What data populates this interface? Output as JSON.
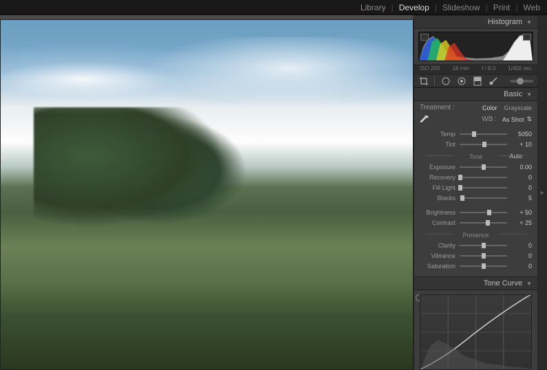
{
  "modules": {
    "library": "Library",
    "develop": "Develop",
    "slideshow": "Slideshow",
    "print": "Print",
    "web": "Web",
    "active": "develop"
  },
  "panels": {
    "histogram": "Histogram",
    "basic": "Basic",
    "tone_curve": "Tone Curve"
  },
  "histogram_meta": {
    "iso": "ISO 200",
    "focal": "18 mm",
    "aperture": "f / 8.0",
    "shutter": "1/400 sec"
  },
  "treatment": {
    "label": "Treatment :",
    "color": "Color",
    "grayscale": "Grayscale"
  },
  "wb": {
    "label": "WB :",
    "preset": "As Shot"
  },
  "tone_label": "Tone",
  "auto_label": "Auto",
  "presence_label": "Presence",
  "sliders": {
    "temp": {
      "label": "Temp",
      "value": "5050",
      "pos": 30
    },
    "tint": {
      "label": "Tint",
      "value": "+ 10",
      "pos": 52
    },
    "exposure": {
      "label": "Exposure",
      "value": "0.00",
      "pos": 50
    },
    "recovery": {
      "label": "Recovery",
      "value": "0",
      "pos": 2
    },
    "fill_light": {
      "label": "Fill Light",
      "value": "0",
      "pos": 2
    },
    "blacks": {
      "label": "Blacks",
      "value": "5",
      "pos": 6
    },
    "brightness": {
      "label": "Brightness",
      "value": "+ 50",
      "pos": 62
    },
    "contrast": {
      "label": "Contrast",
      "value": "+ 25",
      "pos": 60
    },
    "clarity": {
      "label": "Clarity",
      "value": "0",
      "pos": 50
    },
    "vibrance": {
      "label": "Vibrance",
      "value": "0",
      "pos": 50
    },
    "saturation": {
      "label": "Saturation",
      "value": "0",
      "pos": 50
    }
  }
}
